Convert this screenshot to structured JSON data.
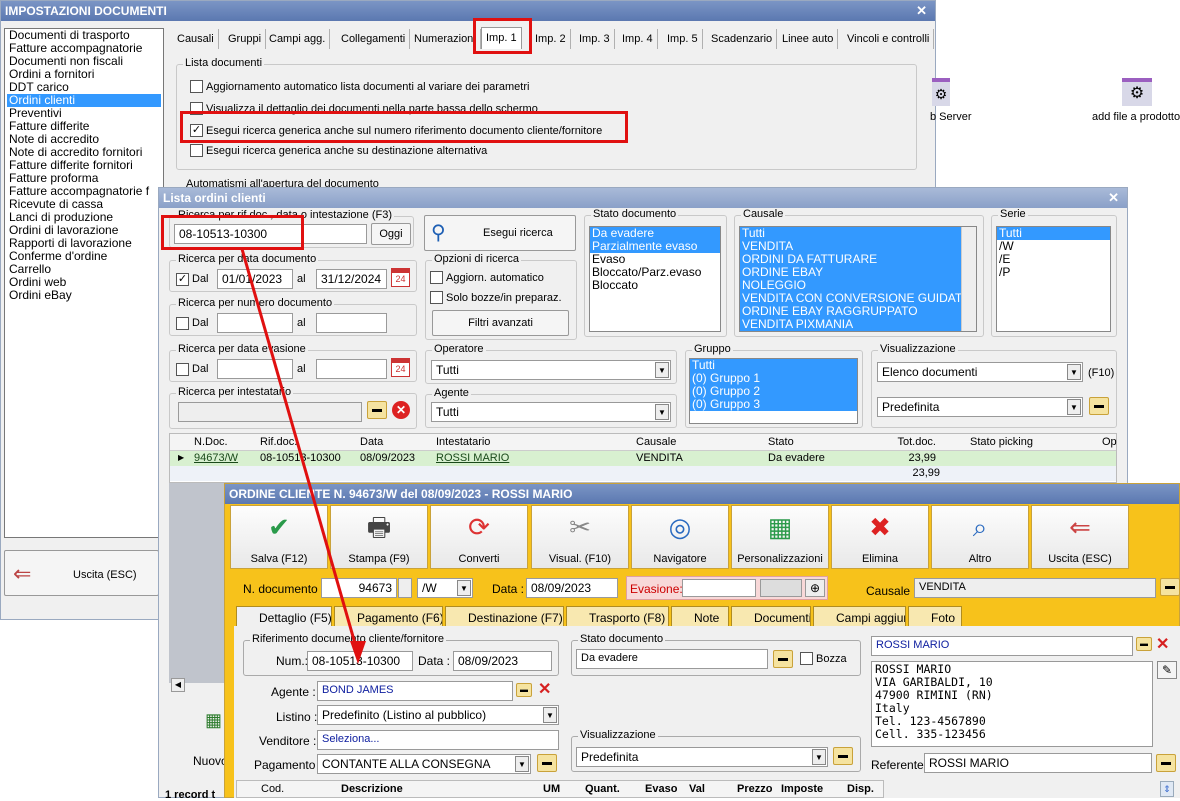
{
  "imp": {
    "title": "IMPOSTAZIONI DOCUMENTI",
    "close": "✕",
    "sidebar": [
      "Documenti di trasporto",
      "Fatture accompagnatorie",
      "Documenti non fiscali",
      "Ordini a fornitori",
      "DDT carico",
      "Ordini clienti",
      "Preventivi",
      "Fatture differite",
      "Note di accredito",
      "Note di accredito fornitori",
      "Fatture differite fornitori",
      "Fatture proforma",
      "Fatture accompagnatorie f",
      "Ricevute di cassa",
      "Lanci di produzione",
      "Ordini di lavorazione",
      "Rapporti di lavorazione",
      "Conferme d'ordine",
      "Carrello",
      "Ordini web",
      "Ordini eBay"
    ],
    "exit": "Uscita (ESC)",
    "tabs": [
      "Causali",
      "Gruppi",
      "Campi agg.",
      "Collegamenti",
      "Numerazioni",
      "Imp. 1",
      "Imp. 2",
      "Imp. 3",
      "Imp. 4",
      "Imp. 5",
      "Scadenzario",
      "Linee auto",
      "Vincoli e controlli"
    ],
    "group_label": "Lista documenti",
    "options": [
      "Aggiornamento automatico lista documenti al variare dei parametri",
      "Visualizza il dettaglio dei documenti nella parte bassa dello schermo",
      "Esegui ricerca generica anche sul numero riferimento documento cliente/fornitore",
      "Esegui ricerca generica anche su destinazione alternativa"
    ],
    "group2_label": "Automatismi all'apertura del documento"
  },
  "desktop": {
    "icon1": "b Server",
    "icon2": "add file a prodotto"
  },
  "lista": {
    "title": "Lista ordini clienti",
    "close": "✕",
    "search_label": "Ricerca per rif.doc., data o intestazione (F3)",
    "search_value": "08-10513-10300",
    "oggi": "Oggi",
    "esegui": "Esegui ricerca",
    "data_doc_label": "Ricerca per data documento",
    "dal": "Dal",
    "al": "al",
    "date_from": "01/01/2023",
    "date_to": "31/12/2024",
    "cal": "24",
    "opz_label": "Opzioni di ricerca",
    "opz1": "Aggiorn. automatico",
    "opz2": "Solo bozze/in preparaz.",
    "filtri": "Filtri avanzati",
    "num_label": "Ricerca per numero documento",
    "evas_label": "Ricerca per data evasione",
    "intest_label": "Ricerca per intestatario",
    "stato_label": "Stato documento",
    "stato": [
      "Da evadere",
      "Parzialmente evaso",
      "Evaso",
      "Bloccato/Parz.evaso",
      "Bloccato"
    ],
    "causale_label": "Causale",
    "causale": [
      "Tutti",
      "VENDITA",
      "ORDINI DA FATTURARE",
      "ORDINE EBAY",
      "NOLEGGIO",
      "VENDITA CON CONVERSIONE GUIDAT",
      "ORDINE EBAY RAGGRUPPATO",
      "VENDITA PIXMANIA"
    ],
    "serie_label": "Serie",
    "serie": [
      "Tutti",
      "",
      "/W",
      "/E",
      "/P"
    ],
    "operatore_label": "Operatore",
    "operatore": "Tutti",
    "agente_label": "Agente",
    "agente": "Tutti",
    "gruppo_label": "Gruppo",
    "gruppo": [
      "Tutti",
      "(0) Gruppo 1",
      "(0) Gruppo 2",
      "(0) Gruppo 3"
    ],
    "vis_label": "Visualizzazione",
    "vis1": "Elenco documenti",
    "f10": "(F10)",
    "vis2": "Predefinita",
    "cols": [
      "N.Doc.",
      "Rif.doc.",
      "Data",
      "Intestatario",
      "Causale",
      "Stato",
      "Tot.doc.",
      "Stato picking",
      "Op"
    ],
    "row": [
      "94673/W",
      "08-10513-10300",
      "08/09/2023",
      "ROSSI MARIO",
      "VENDITA",
      "Da evadere",
      "23,99"
    ],
    "total": "23,99",
    "nuovo": "Nuovo",
    "footer": "1 record t"
  },
  "ordine": {
    "title": "ORDINE CLIENTE N. 94673/W del 08/09/2023 - ROSSI MARIO",
    "toolbar": [
      "Salva (F12)",
      "Stampa (F9)",
      "Converti",
      "Visual. (F10)",
      "Navigatore",
      "Personalizzazioni",
      "Elimina",
      "Altro",
      "Uscita (ESC)"
    ],
    "ndoc_label": "N. documento :",
    "ndoc": "94673",
    "serie": "/W",
    "data_label": "Data :",
    "data": "08/09/2023",
    "evas_label": "Evasione:",
    "causale_label": "Causale :",
    "causale": "VENDITA",
    "tabs": [
      "Dettaglio (F5)",
      "Pagamento (F6)",
      "Destinazione (F7)",
      "Trasporto (F8)",
      "Note",
      "Documenti",
      "Campi aggiuntivi",
      "Foto"
    ],
    "rif_label": "Riferimento documento cliente/fornitore",
    "num_label": "Num.:",
    "num": "08-10513-10300",
    "rdata_label": "Data :",
    "rdata": "08/09/2023",
    "stato_label": "Stato documento",
    "stato": "Da evadere",
    "bozza": "Bozza",
    "cliente": "ROSSI MARIO",
    "address": [
      "ROSSI MARIO",
      "VIA GARIBALDI, 10",
      "47900 RIMINI (RN)",
      "Italy",
      "Tel. 123-4567890",
      "Cell. 335-123456"
    ],
    "agente_label": "Agente :",
    "agente": "BOND JAMES",
    "listino_label": "Listino :",
    "listino": "Predefinito (Listino al pubblico)",
    "venditore_label": "Venditore :",
    "venditore": "Seleziona...",
    "pagamento_label": "Pagamento :",
    "pagamento": "CONTANTE ALLA CONSEGNA",
    "vis_label": "Visualizzazione",
    "vis": "Predefinita",
    "referente_label": "Referente",
    "referente": "ROSSI MARIO",
    "cols": [
      "Cod.",
      "Descrizione",
      "UM",
      "Quant.",
      "Evaso",
      "Val",
      "Prezzo",
      "Imposte",
      "Disp."
    ]
  },
  "colors": {
    "highlight": "#e01010",
    "accent": "#3399ff",
    "toolbar": "#f7c21b"
  }
}
